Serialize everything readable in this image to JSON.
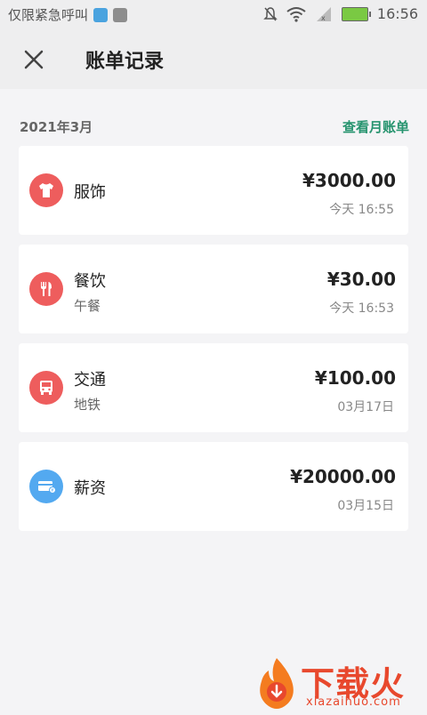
{
  "status_bar": {
    "carrier": "仅限紧急呼叫",
    "time": "16:56"
  },
  "header": {
    "title": "账单记录"
  },
  "month": {
    "label": "2021年3月",
    "link": "查看月账单"
  },
  "records": [
    {
      "category": "服饰",
      "note": "",
      "amount": "¥3000.00",
      "time": "今天 16:55",
      "icon": "shirt-icon",
      "color": "#ee5d5d"
    },
    {
      "category": "餐饮",
      "note": "午餐",
      "amount": "¥30.00",
      "time": "今天 16:53",
      "icon": "fork-knife-icon",
      "color": "#ee5d5d"
    },
    {
      "category": "交通",
      "note": "地铁",
      "amount": "¥100.00",
      "time": "03月17日",
      "icon": "bus-icon",
      "color": "#ee5d5d"
    },
    {
      "category": "薪资",
      "note": "",
      "amount": "¥20000.00",
      "time": "03月15日",
      "icon": "card-icon",
      "color": "#53a9f0"
    }
  ],
  "watermark": {
    "title": "下载火",
    "subtitle": "xiazaihuo.com"
  }
}
